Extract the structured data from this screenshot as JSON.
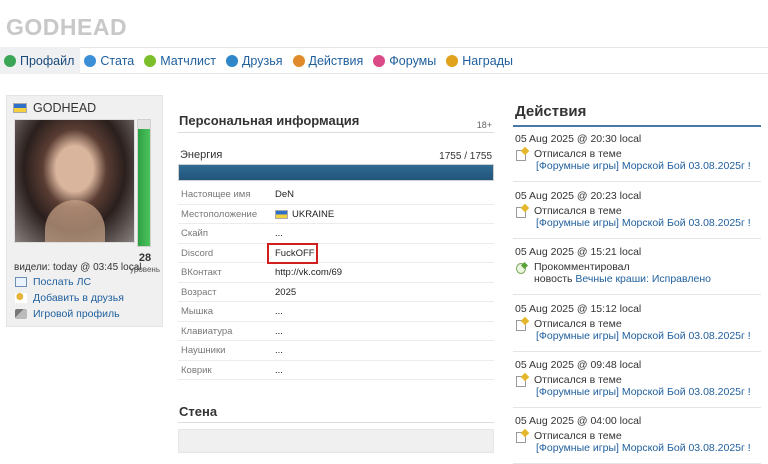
{
  "site_title": "GODHEAD",
  "tabs": [
    {
      "label": "Профайл",
      "icon": "smiley-icon",
      "color": "#3aa655",
      "active": true
    },
    {
      "label": "Стата",
      "icon": "info-icon",
      "color": "#3b8fd6"
    },
    {
      "label": "Матчлист",
      "icon": "radiation-icon",
      "color": "#7cbf2a"
    },
    {
      "label": "Друзья",
      "icon": "friends-icon",
      "color": "#2f87c9"
    },
    {
      "label": "Действия",
      "icon": "actions-icon",
      "color": "#e08a2c"
    },
    {
      "label": "Форумы",
      "icon": "forum-icon",
      "color": "#d94a86"
    },
    {
      "label": "Награды",
      "icon": "award-icon",
      "color": "#e0a21d"
    }
  ],
  "profile": {
    "username": "GODHEAD",
    "level": "28",
    "level_label": "уровень",
    "level_fill": 0.93,
    "last_seen": "видели: today @ 03:45 local",
    "links": [
      {
        "label": "Послать ЛС",
        "icon": "mail-icon"
      },
      {
        "label": "Добавить в друзья",
        "icon": "add-friend-icon"
      },
      {
        "label": "Игровой профиль",
        "icon": "game-profile-icon"
      }
    ]
  },
  "personal": {
    "title": "Персональная информация",
    "age_badge": "18+",
    "energy_label": "Энергия",
    "energy_value": "1755 / 1755",
    "energy_fraction": 1.0,
    "rows": [
      {
        "key": "Настоящее имя",
        "value": "DeN"
      },
      {
        "key": "Местоположение",
        "value": "UKRAINE",
        "flag": true
      },
      {
        "key": "Скайп",
        "value": "..."
      },
      {
        "key": "Discord",
        "value": "FuckOFF",
        "highlight": true
      },
      {
        "key": "ВКонтакт",
        "value": "http://vk.com/69"
      },
      {
        "key": "Возраст",
        "value": "2025"
      },
      {
        "key": "Мышка",
        "value": "..."
      },
      {
        "key": "Клавиатура",
        "value": "..."
      },
      {
        "key": "Наушники",
        "value": "..."
      },
      {
        "key": "Коврик",
        "value": "..."
      }
    ]
  },
  "wall": {
    "title": "Стена"
  },
  "activity": {
    "title": "Действия",
    "items": [
      {
        "date": "05 Aug 2025 @ 20:30 local",
        "action": "Отписался в теме",
        "link": "[Форумные игры] Морской Бой 03.08.2025г !",
        "type": "post"
      },
      {
        "date": "05 Aug 2025 @ 20:23 local",
        "action": "Отписался в теме",
        "link": "[Форумные игры] Морской Бой 03.08.2025г !",
        "type": "post"
      },
      {
        "date": "05 Aug 2025 @ 15:21 local",
        "action": "Прокомментировал",
        "action2": "новость",
        "link": "Вечные краши: Исправлено",
        "type": "comment"
      },
      {
        "date": "05 Aug 2025 @ 15:12 local",
        "action": "Отписался в теме",
        "link": "[Форумные игры] Морской Бой 03.08.2025г !",
        "type": "post"
      },
      {
        "date": "05 Aug 2025 @ 09:48 local",
        "action": "Отписался в теме",
        "link": "[Форумные игры] Морской Бой 03.08.2025г !",
        "type": "post"
      },
      {
        "date": "05 Aug 2025 @ 04:00 local",
        "action": "Отписался в теме",
        "link": "[Форумные игры] Морской Бой 03.08.2025г !",
        "type": "post"
      }
    ]
  }
}
